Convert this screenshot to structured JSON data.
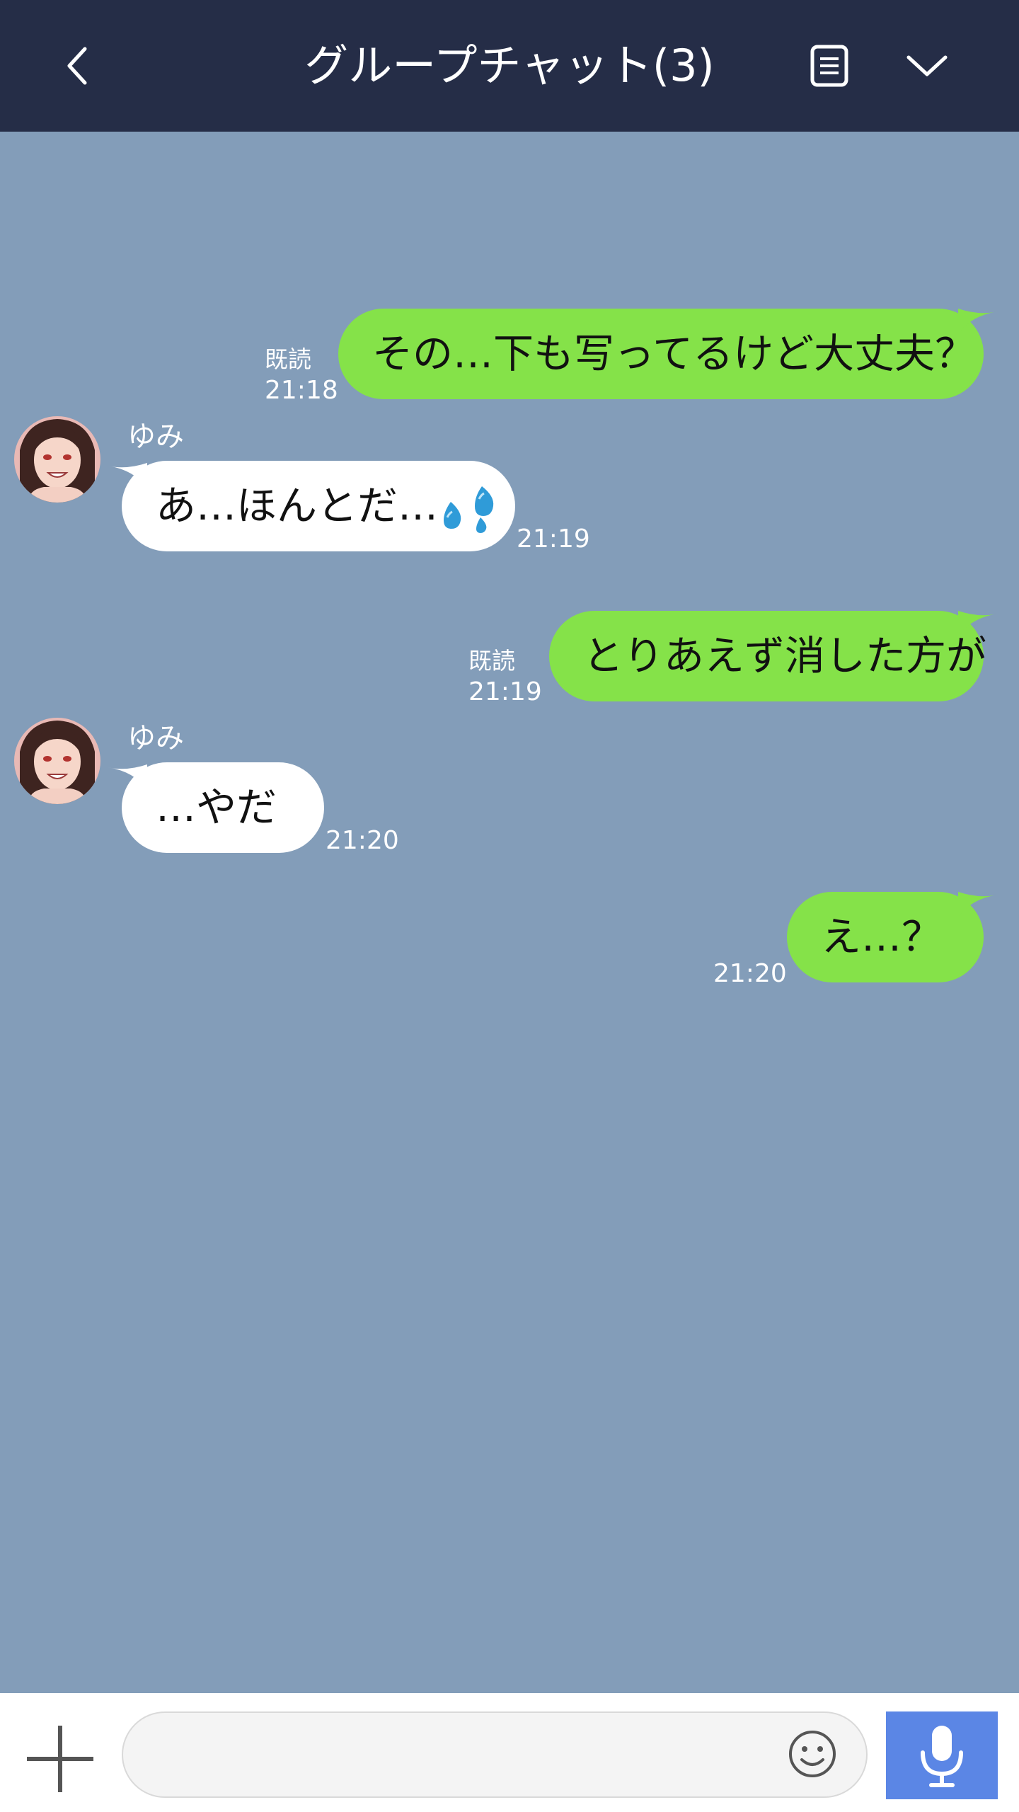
{
  "header": {
    "title": "グループチャット(3)",
    "back_icon": "chevron-left-icon",
    "notes_icon": "notes-icon",
    "menu_icon": "chevron-down-icon",
    "background": "#252d47"
  },
  "chat": {
    "background": "#839db9",
    "outgoing_color": "#85e249",
    "incoming_color": "#ffffff",
    "messages": [
      {
        "direction": "out",
        "text": "その…下も写ってるけど大丈夫？",
        "read_label": "既読",
        "time": "21:18"
      },
      {
        "direction": "in",
        "sender": "ゆみ",
        "text": "あ…ほんとだ…",
        "emoji": "sweat-drops-icon",
        "time": "21:19"
      },
      {
        "direction": "out",
        "text": "とりあえず消した方が",
        "read_label": "既読",
        "time": "21:19"
      },
      {
        "direction": "in",
        "sender": "ゆみ",
        "text": "…やだ",
        "time": "21:20"
      },
      {
        "direction": "out",
        "text": "え…？",
        "time": "21:20"
      }
    ]
  },
  "footer": {
    "plus_icon": "plus-icon",
    "input_value": "",
    "input_placeholder": "",
    "emoji_icon": "smiley-icon",
    "mic_icon": "microphone-icon",
    "mic_color": "#5b86e5"
  }
}
